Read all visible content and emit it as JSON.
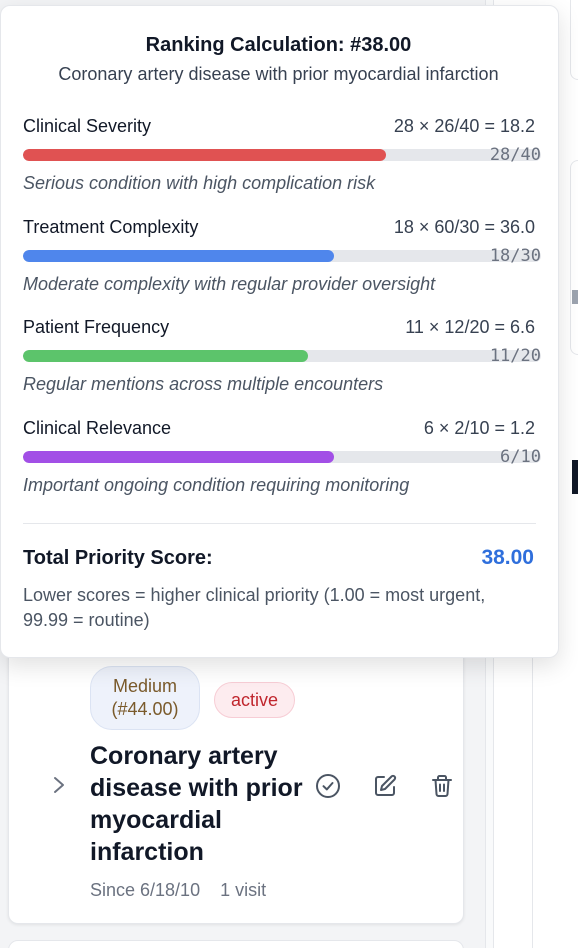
{
  "popover": {
    "title": "Ranking Calculation: #38.00",
    "subtitle": "Coronary artery disease with prior myocardial infarction",
    "factors": [
      {
        "name": "Clinical Severity",
        "calc": "28 × 26/40 = 18.2",
        "fraction": "28/40",
        "value": 28,
        "max": 40,
        "color": "#e05252",
        "description": "Serious condition with high complication risk"
      },
      {
        "name": "Treatment Complexity",
        "calc": "18 × 60/30 = 36.0",
        "fraction": "18/30",
        "value": 18,
        "max": 30,
        "color": "#4f86ec",
        "description": "Moderate complexity with regular provider oversight"
      },
      {
        "name": "Patient Frequency",
        "calc": "11 × 12/20 = 6.6",
        "fraction": "11/20",
        "value": 11,
        "max": 20,
        "color": "#5cc46b",
        "description": "Regular mentions across multiple encounters"
      },
      {
        "name": "Clinical Relevance",
        "calc": "6 × 2/10 = 1.2",
        "fraction": "6/10",
        "value": 6,
        "max": 10,
        "color": "#a24fe6",
        "description": "Important ongoing condition requiring monitoring"
      }
    ],
    "total_label": "Total Priority Score:",
    "total_value": "38.00",
    "total_note": "Lower scores = higher clinical priority (1.00 = most urgent, 99.99 = routine)"
  },
  "condition": {
    "priority_badge": "Medium (#44.00)",
    "status_badge": "active",
    "title": "Coronary artery disease with prior myocardial infarction",
    "since": "Since 6/18/10",
    "visits": "1 visit"
  },
  "icons": {
    "expand": "chevron-right-icon",
    "resolve": "check-circle-icon",
    "edit": "edit-icon",
    "delete": "trash-icon"
  }
}
